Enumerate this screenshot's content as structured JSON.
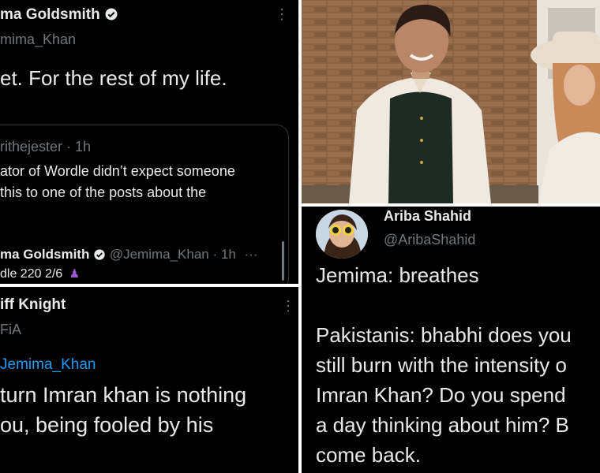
{
  "panel1": {
    "name": "ma Goldsmith",
    "handle": "mima_Khan",
    "text": "et. For the rest of my life.",
    "quote": {
      "user": "rithejester · 1h",
      "line1": "ator of Wordle didn’t expect someone",
      "line2": "this to one of the posts about the"
    },
    "reply": {
      "name": "ma Goldsmith",
      "handle": "@Jemima_Khan · 1h",
      "more": "···",
      "text": "dle 220 2/6"
    }
  },
  "panel2": {
    "description": ""
  },
  "panel3": {
    "name": "iff Knight",
    "handle": "FiA",
    "mention": "Jemima_Khan",
    "line1": "turn Imran khan is nothing",
    "line2": "ou, being fooled by his"
  },
  "panel4": {
    "name": "Ariba Shahid",
    "handle": "@AribaShahid",
    "line1": "Jemima: breathes",
    "line2": "Pakistanis: bhabhi does you",
    "line3": "still burn with the intensity o",
    "line4": "Imran Khan? Do you spend",
    "line5": "a day thinking about him? B",
    "line6": "come back."
  },
  "colors": {
    "twitter_blue": "#1d9bf0",
    "background": "#000000",
    "text": "#e7e9ea",
    "secondary": "#71767b"
  }
}
